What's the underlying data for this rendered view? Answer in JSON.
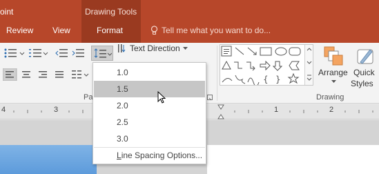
{
  "titlebar": {
    "app_title": "oint",
    "context_group": "Drawing Tools"
  },
  "tabs": {
    "review": "Review",
    "view": "View",
    "format": "Format"
  },
  "tell_me": {
    "placeholder": "Tell me what you want to do..."
  },
  "ribbon": {
    "text_direction": "Text Direction",
    "paragraph_group_label": "Pa",
    "drawing_group_label": "Drawing",
    "arrange_label": "Arrange",
    "quick_styles_label_1": "Quick",
    "quick_styles_label_2": "Styles"
  },
  "ruler": {
    "marks": [
      "4",
      "3",
      "1",
      "2"
    ]
  },
  "line_spacing_menu": {
    "items": [
      "1.0",
      "1.5",
      "2.0",
      "2.5",
      "3.0"
    ],
    "selected": "1.5",
    "options_prefix": "L",
    "options_rest": "ine Spacing Options..."
  },
  "colors": {
    "accent": "#b7472a",
    "context_tab": "#9a3a20",
    "selected_item": "#c6c6c6"
  }
}
